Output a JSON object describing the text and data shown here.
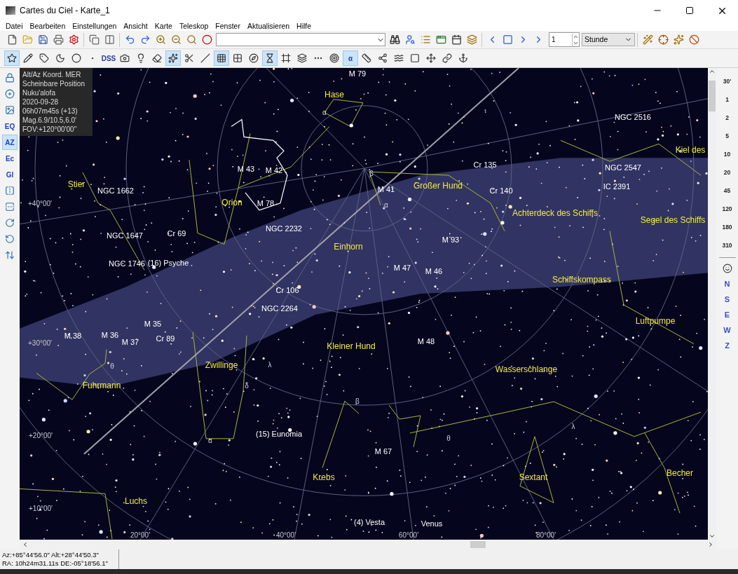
{
  "window": {
    "title": "Cartes du Ciel - Karte_1"
  },
  "menu": [
    "Datei",
    "Bearbeiten",
    "Einstellungen",
    "Ansicht",
    "Karte",
    "Teleskop",
    "Fenster",
    "Aktualisieren",
    "Hilfe"
  ],
  "toolbar_1": {
    "step_value": "1",
    "unit_select": "Stunde"
  },
  "toolbar_2": [
    {
      "kind": "icon",
      "selected": true
    },
    {
      "kind": "icon",
      "selected": false
    },
    {
      "kind": "icon",
      "selected": false
    },
    {
      "kind": "icon",
      "selected": false
    },
    {
      "kind": "icon",
      "selected": false
    },
    {
      "kind": "icon",
      "selected": false
    },
    {
      "kind": "text",
      "label": "DSS",
      "selected": false
    },
    {
      "kind": "icon",
      "selected": false
    },
    {
      "kind": "icon",
      "selected": false
    },
    {
      "kind": "icon",
      "selected": false
    },
    {
      "kind": "icon",
      "selected": true
    },
    {
      "kind": "icon",
      "selected": false
    },
    {
      "kind": "icon",
      "selected": false
    },
    {
      "kind": "icon",
      "selected": true
    },
    {
      "kind": "icon",
      "selected": false
    },
    {
      "kind": "icon",
      "selected": false
    },
    {
      "kind": "icon",
      "selected": true
    },
    {
      "kind": "icon",
      "selected": false
    },
    {
      "kind": "icon",
      "selected": false
    },
    {
      "kind": "icon",
      "selected": false
    },
    {
      "kind": "icon",
      "selected": false
    },
    {
      "kind": "text",
      "label": "α",
      "selected": true
    },
    {
      "kind": "icon",
      "selected": false
    },
    {
      "kind": "icon",
      "selected": false
    },
    {
      "kind": "icon",
      "selected": false
    },
    {
      "kind": "icon",
      "selected": false
    },
    {
      "kind": "icon",
      "selected": false
    },
    {
      "kind": "icon",
      "selected": false
    },
    {
      "kind": "icon",
      "selected": false
    }
  ],
  "left_toolbar": [
    {
      "kind": "icon",
      "selected": false
    },
    {
      "kind": "icon",
      "selected": false
    },
    {
      "kind": "icon",
      "selected": false
    },
    {
      "kind": "text",
      "label": "EQ",
      "selected": false
    },
    {
      "kind": "text",
      "label": "AZ",
      "selected": true
    },
    {
      "kind": "text",
      "label": "Ec",
      "selected": false
    },
    {
      "kind": "text",
      "label": "Gl",
      "selected": false
    },
    {
      "kind": "icon",
      "selected": false
    },
    {
      "kind": "icon",
      "selected": false
    },
    {
      "kind": "icon",
      "selected": false
    },
    {
      "kind": "icon",
      "selected": false
    },
    {
      "kind": "icon",
      "selected": false
    }
  ],
  "info_panel": [
    "Alt/Az Koord. MER",
    "Scheinbare Position",
    "Nuku'alofa",
    "2020-09-28",
    "06h07m45s (+13)",
    "Mag.6.9/10.5,6.0'",
    "FOV:+120°00'00\""
  ],
  "chart_labels": [
    {
      "kind": "constellation",
      "text": "Hase"
    },
    {
      "kind": "constellation",
      "text": "Orion"
    },
    {
      "kind": "constellation",
      "text": "Stier"
    },
    {
      "kind": "constellation",
      "text": "Großer Hund"
    },
    {
      "kind": "constellation",
      "text": "Kiel des"
    },
    {
      "kind": "constellation",
      "text": "Achterdeck des Schiffs"
    },
    {
      "kind": "constellation",
      "text": "Segel des Schiffs"
    },
    {
      "kind": "constellation",
      "text": "Einhorn"
    },
    {
      "kind": "constellation",
      "text": "Schiffskompass"
    },
    {
      "kind": "constellation",
      "text": "Luftpumpe"
    },
    {
      "kind": "constellation",
      "text": "Kleiner Hund"
    },
    {
      "kind": "constellation",
      "text": "Zwillinge"
    },
    {
      "kind": "constellation",
      "text": "Fuhrmann"
    },
    {
      "kind": "constellation",
      "text": "Wasserschlange"
    },
    {
      "kind": "constellation",
      "text": "Krebs"
    },
    {
      "kind": "constellation",
      "text": "Sextant"
    },
    {
      "kind": "constellation",
      "text": "Becher"
    },
    {
      "kind": "constellation",
      "text": "Luchs"
    },
    {
      "kind": "object",
      "text": "M 79"
    },
    {
      "kind": "object",
      "text": "NGC 2516"
    },
    {
      "kind": "object",
      "text": "M 43"
    },
    {
      "kind": "object",
      "text": "M 42"
    },
    {
      "kind": "object",
      "text": "M 78"
    },
    {
      "kind": "object",
      "text": "NGC 1662"
    },
    {
      "kind": "object",
      "text": "NGC 1647"
    },
    {
      "kind": "object",
      "text": "Cr 69"
    },
    {
      "kind": "object",
      "text": "NGC 2232"
    },
    {
      "kind": "object",
      "text": "Cr 135"
    },
    {
      "kind": "object",
      "text": "NGC 2547"
    },
    {
      "kind": "object",
      "text": "IC 2391"
    },
    {
      "kind": "object",
      "text": "M 41"
    },
    {
      "kind": "object",
      "text": "Cr 140"
    },
    {
      "kind": "object",
      "text": "M 93"
    },
    {
      "kind": "object",
      "text": "NGC 1746"
    },
    {
      "kind": "object",
      "text": "(16) Psyche"
    },
    {
      "kind": "object",
      "text": "M 47"
    },
    {
      "kind": "object",
      "text": "M 46"
    },
    {
      "kind": "object",
      "text": "Cr 106"
    },
    {
      "kind": "object",
      "text": "NGC 2264"
    },
    {
      "kind": "object",
      "text": "M 35"
    },
    {
      "kind": "object",
      "text": "M 38"
    },
    {
      "kind": "object",
      "text": "M 36"
    },
    {
      "kind": "object",
      "text": "M 37"
    },
    {
      "kind": "object",
      "text": "Cr 89"
    },
    {
      "kind": "object",
      "text": "M 48"
    },
    {
      "kind": "object",
      "text": "(15) Eunomia"
    },
    {
      "kind": "object",
      "text": "M 67"
    },
    {
      "kind": "object",
      "text": "(4) Vesta"
    },
    {
      "kind": "object",
      "text": "Venus"
    },
    {
      "kind": "grid",
      "text": "+40°00'"
    },
    {
      "kind": "grid",
      "text": "+30°00'"
    },
    {
      "kind": "grid",
      "text": "+20°00'"
    },
    {
      "kind": "grid",
      "text": "+10°00'"
    },
    {
      "kind": "grid",
      "text": "20°00'"
    },
    {
      "kind": "grid",
      "text": "40°00'"
    },
    {
      "kind": "grid",
      "text": "60°00'"
    },
    {
      "kind": "grid",
      "text": "80°00'"
    },
    {
      "kind": "greek",
      "text": "α"
    },
    {
      "kind": "greek",
      "text": "β"
    },
    {
      "kind": "greek",
      "text": "α"
    },
    {
      "kind": "greek",
      "text": "β"
    },
    {
      "kind": "greek",
      "text": "λ"
    },
    {
      "kind": "greek",
      "text": "α"
    },
    {
      "kind": "greek",
      "text": "θ"
    },
    {
      "kind": "greek",
      "text": "δ"
    },
    {
      "kind": "greek",
      "text": "θ"
    },
    {
      "kind": "greek",
      "text": "λ"
    }
  ],
  "scale_buttons": [
    {
      "label": "30'"
    },
    {
      "label": "1"
    },
    {
      "label": "2"
    },
    {
      "label": "5"
    },
    {
      "label": "10"
    },
    {
      "label": "20"
    },
    {
      "label": "45"
    },
    {
      "label": "120"
    },
    {
      "label": "180"
    },
    {
      "label": "310"
    }
  ],
  "direction_buttons": [
    "N",
    "S",
    "E",
    "W",
    "Z"
  ],
  "status_bar": [
    "Az:+85°44'56.0\" Alt:+28°44'50.3\"",
    "RA: 10h24m31.11s DE:-05°18'56.1\""
  ]
}
